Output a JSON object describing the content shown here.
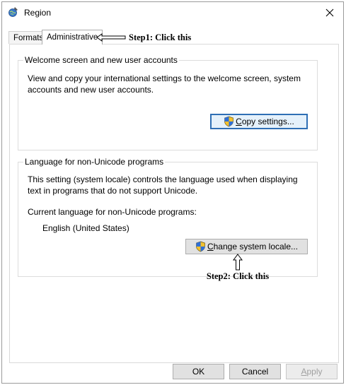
{
  "window": {
    "title": "Region"
  },
  "tabs": [
    {
      "label": "Formats",
      "active": false
    },
    {
      "label": "Administrative",
      "active": true
    }
  ],
  "annotations": {
    "step1": "Step1: Click this",
    "step2": "Step2: Click this"
  },
  "welcome_group": {
    "title": "Welcome screen and new user accounts",
    "description": "View and copy your international settings to the welcome screen, system accounts and new user accounts.",
    "button_prefix": "C",
    "button_rest": "opy settings..."
  },
  "locale_group": {
    "title": "Language for non-Unicode programs",
    "description": "This setting (system locale) controls the language used when displaying text in programs that do not support Unicode.",
    "current_label": "Current language for non-Unicode programs:",
    "current_value": "English (United States)",
    "button_prefix": "C",
    "button_rest": "hange system locale..."
  },
  "footer": {
    "ok": "OK",
    "cancel": "Cancel",
    "apply_prefix": "A",
    "apply_rest": "pply"
  },
  "icons": {
    "app": "globe-pen-icon",
    "close": "close-icon",
    "shield": "uac-shield-icon",
    "arrow_left": "hollow-arrow-left-icon",
    "arrow_up": "hollow-arrow-up-icon"
  },
  "colors": {
    "focus_border": "#2f6fb5",
    "button_face": "#e1e1e1",
    "disabled_text": "#a0a0a0"
  }
}
